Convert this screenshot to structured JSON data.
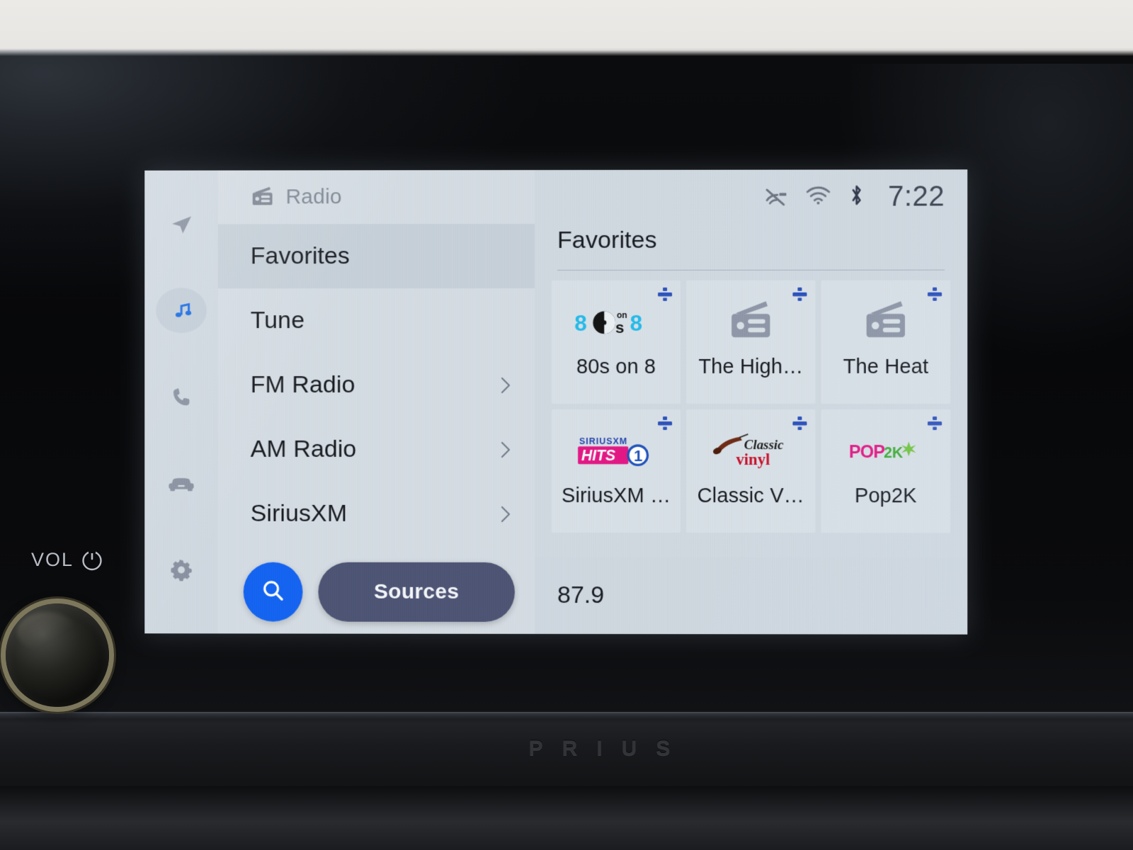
{
  "hardware": {
    "vol_label": "VOL",
    "power_icon": "power-icon",
    "knob": "volume-knob",
    "model_badge": "PRIUS"
  },
  "rail": {
    "items": [
      {
        "icon": "navigation-arrow-icon",
        "name": "navigation",
        "active": false
      },
      {
        "icon": "music-note-icon",
        "name": "media",
        "active": true
      },
      {
        "icon": "phone-icon",
        "name": "phone",
        "active": false
      },
      {
        "icon": "car-icon",
        "name": "vehicle",
        "active": false
      },
      {
        "icon": "gear-icon",
        "name": "settings",
        "active": false
      }
    ]
  },
  "source_header": {
    "icon": "radio-icon",
    "label": "Radio"
  },
  "menu": {
    "items": [
      {
        "label": "Favorites",
        "selected": true,
        "chevron": false
      },
      {
        "label": "Tune",
        "selected": false,
        "chevron": false
      },
      {
        "label": "FM Radio",
        "selected": false,
        "chevron": true
      },
      {
        "label": "AM Radio",
        "selected": false,
        "chevron": true
      },
      {
        "label": "SiriusXM",
        "selected": false,
        "chevron": true
      }
    ]
  },
  "actions": {
    "search_icon": "search-icon",
    "sources_label": "Sources"
  },
  "statusbar": {
    "icons": [
      {
        "name": "mute-icon"
      },
      {
        "name": "wifi-icon"
      },
      {
        "name": "bluetooth-icon"
      }
    ],
    "time": "7:22"
  },
  "content": {
    "title": "Favorites",
    "favorites": [
      {
        "name": "80s on 8",
        "art": "logo-80s-on-8",
        "badge": "siriusxm-badge"
      },
      {
        "name": "The High…",
        "art": "generic-radio",
        "badge": "siriusxm-badge"
      },
      {
        "name": "The Heat",
        "art": "generic-radio",
        "badge": "siriusxm-badge"
      },
      {
        "name": "SiriusXM …",
        "art": "logo-hits-1",
        "badge": "siriusxm-badge"
      },
      {
        "name": "Classic V…",
        "art": "logo-classic-vinyl",
        "badge": "siriusxm-badge"
      },
      {
        "name": "Pop2K",
        "art": "logo-pop2k",
        "badge": "siriusxm-badge"
      }
    ]
  },
  "now_playing": {
    "frequency": "87.9"
  },
  "colors": {
    "screen_bg": "#ccd5dd",
    "list_bg": "#d2dae1",
    "tile_bg": "#d6dee5",
    "selected_row": "#c3cdd6",
    "accent_blue": "#1460f0",
    "sources_btn": "#4b5170",
    "text_primary": "#171a1f",
    "text_muted": "#7b838f",
    "icon_gray": "#8a93a4"
  }
}
